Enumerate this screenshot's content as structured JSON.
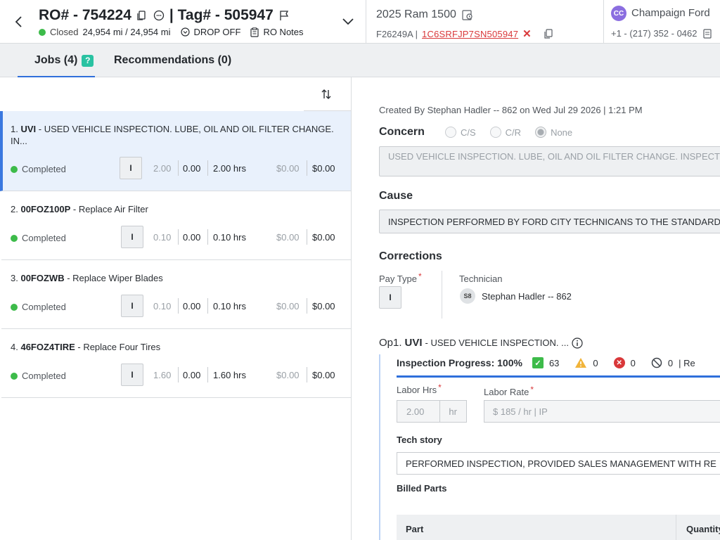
{
  "header": {
    "ro_label": "RO# - 754224",
    "tag_label": "| Tag# - 505947",
    "status": "Closed",
    "mileage": "24,954 mi / 24,954 mi",
    "drop_off": "DROP OFF",
    "ro_notes": "RO Notes",
    "vehicle_name": "2025 Ram 1500",
    "stock_no": "F26249A |",
    "vin": "1C6SRFJP7SN505947",
    "customer_initials": "CC",
    "customer_name": "Champaign Ford",
    "customer_phone": "+1 - (217) 352 - 0462"
  },
  "tabs": [
    {
      "label": "Jobs (4)",
      "badge": "?",
      "active": true
    },
    {
      "label": "Recommendations (0)",
      "active": false
    }
  ],
  "jobs": [
    {
      "index": "1.",
      "code": "UVI",
      "desc": " - USED VEHICLE INSPECTION. LUBE, OIL AND OIL FILTER CHANGE. IN...",
      "status": "Completed",
      "pay_type": "I",
      "sold_hrs": "2.00",
      "actual_hrs": "0.00",
      "total_hrs": "2.00 hrs",
      "cost": "$0.00",
      "price": "$0.00"
    },
    {
      "index": "2.",
      "code": "00FOZ100P",
      "desc": " - Replace Air Filter",
      "status": "Completed",
      "pay_type": "I",
      "sold_hrs": "0.10",
      "actual_hrs": "0.00",
      "total_hrs": "0.10 hrs",
      "cost": "$0.00",
      "price": "$0.00"
    },
    {
      "index": "3.",
      "code": "00FOZWB",
      "desc": " - Replace Wiper Blades",
      "status": "Completed",
      "pay_type": "I",
      "sold_hrs": "0.10",
      "actual_hrs": "0.00",
      "total_hrs": "0.10 hrs",
      "cost": "$0.00",
      "price": "$0.00"
    },
    {
      "index": "4.",
      "code": "46FOZ4TIRE",
      "desc": " - Replace Four Tires",
      "status": "Completed",
      "pay_type": "I",
      "sold_hrs": "1.60",
      "actual_hrs": "0.00",
      "total_hrs": "1.60 hrs",
      "cost": "$0.00",
      "price": "$0.00"
    }
  ],
  "detail": {
    "created_by": "Created By Stephan Hadler -- 862 on Wed Jul 29 2026 | 1:21 PM",
    "concern_title": "Concern",
    "concern_options": [
      "C/S",
      "C/R",
      "None"
    ],
    "concern_text": "USED VEHICLE INSPECTION. LUBE, OIL AND OIL FILTER CHANGE. INSPECT",
    "cause_title": "Cause",
    "cause_text": "INSPECTION PERFORMED BY FORD CITY TECHNICANS TO THE STANDARDS",
    "corrections_title": "Corrections",
    "pay_type_label": "Pay Type",
    "pay_type_value": "I",
    "technician_label": "Technician",
    "technician_initials": "S8",
    "technician_name": "Stephan Hadler -- 862",
    "op_prefix": "Op1.",
    "op_code": "UVI",
    "op_desc": "- USED VEHICLE INSPECTION. ...",
    "inspection_label": "Inspection Progress: 100%",
    "insp_pass": "63",
    "insp_warn": "0",
    "insp_fail": "0",
    "insp_na": "0",
    "insp_more": "| Re",
    "labor_hrs_label": "Labor Hrs",
    "labor_hrs_value": "2.00",
    "labor_hrs_unit": "hr",
    "labor_rate_label": "Labor Rate",
    "labor_rate_value": "$ 185 / hr | IP",
    "tech_story_label": "Tech story",
    "tech_story_text": "PERFORMED INSPECTION, PROVIDED SALES MANAGEMENT WITH RE",
    "billed_parts_label": "Billed Parts",
    "parts_col_part": "Part",
    "parts_col_qty": "Quantity"
  },
  "colors": {
    "accent": "#2f6fdb",
    "selected_row": "#e9f1fc",
    "status_green": "#3dbb4a",
    "vin_red": "#d9383a",
    "avatar_purple": "#8b6ee0"
  }
}
